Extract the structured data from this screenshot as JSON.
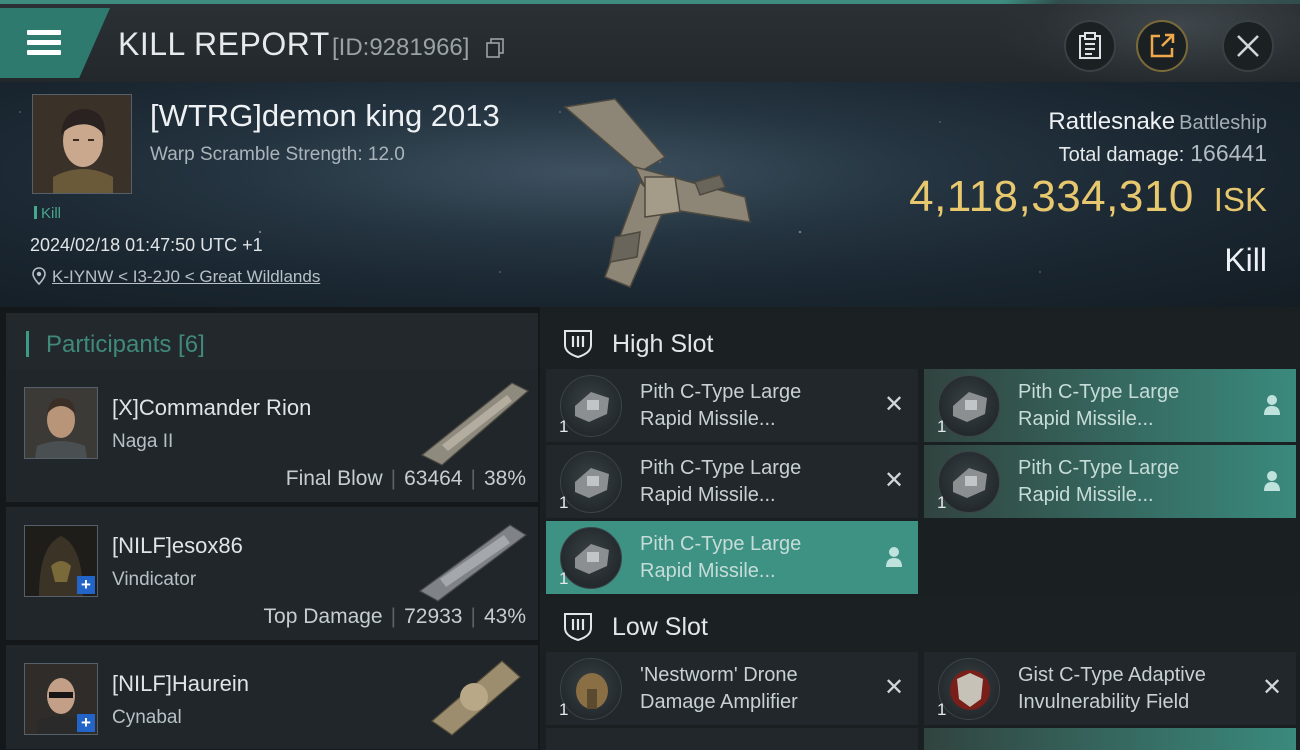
{
  "header": {
    "title": "KILL REPORT",
    "report_id": "[ID:9281966]"
  },
  "victim": {
    "name": "[WTRG]demon king 2013",
    "warp_scramble": "Warp Scramble Strength: 12.0",
    "result_tag": "Kill",
    "datetime": "2024/02/18 01:47:50 UTC +1",
    "location": "K-IYNW < I3-2J0 < Great Wildlands"
  },
  "ship": {
    "name": "Rattlesnake",
    "class": "Battleship",
    "total_damage_label": "Total damage:",
    "total_damage_value": "166441",
    "isk_value": "4,118,334,310",
    "isk_unit": "ISK",
    "result": "Kill"
  },
  "participants": {
    "header": "Participants [6]",
    "rows": [
      {
        "name": "[X]Commander Rion",
        "ship": "Naga II",
        "role": "Final Blow",
        "damage": "63464",
        "percent": "38%"
      },
      {
        "name": "[NILF]esox86",
        "ship": "Vindicator",
        "role": "Top Damage",
        "damage": "72933",
        "percent": "43%"
      },
      {
        "name": "[NILF]Haurein",
        "ship": "Cynabal",
        "role": "",
        "damage": "",
        "percent": ""
      }
    ]
  },
  "slots": {
    "high": {
      "label": "High Slot",
      "items": [
        {
          "line1": "Pith C-Type Large",
          "line2": "Rapid Missile...",
          "qty": "1"
        },
        {
          "line1": "Pith C-Type Large",
          "line2": "Rapid Missile...",
          "qty": "1"
        },
        {
          "line1": "Pith C-Type Large",
          "line2": "Rapid Missile...",
          "qty": "1"
        },
        {
          "line1": "Pith C-Type Large",
          "line2": "Rapid Missile...",
          "qty": "1"
        },
        {
          "line1": "Pith C-Type Large",
          "line2": "Rapid Missile...",
          "qty": "1"
        }
      ]
    },
    "low": {
      "label": "Low Slot",
      "items": [
        {
          "line1": "'Nestworm' Drone",
          "line2": "Damage Amplifier",
          "qty": "1"
        },
        {
          "line1": "Gist C-Type Adaptive",
          "line2": "Invulnerability Field",
          "qty": "1"
        }
      ]
    }
  },
  "colors": {
    "accent": "#3d9283",
    "isk": "#e8c86e"
  }
}
